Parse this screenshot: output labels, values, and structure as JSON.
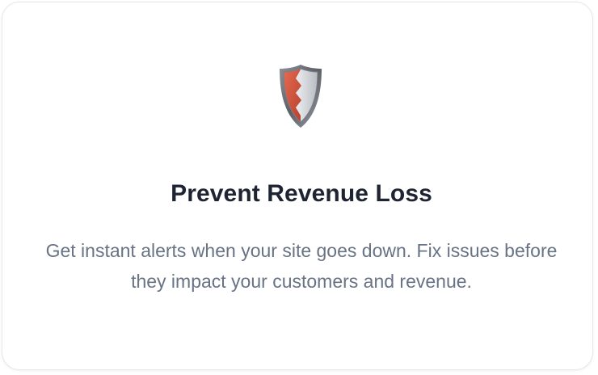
{
  "feature_card": {
    "icon": "shield-icon",
    "title": "Prevent Revenue Loss",
    "description": "Get instant alerts when your site goes down. Fix issues before they impact your customers and revenue.",
    "colors": {
      "title": "#1f2433",
      "description": "#687385",
      "shield_red": "#d9543e",
      "shield_silver": "#c9ccd1",
      "border": "#e3e6eb"
    }
  }
}
